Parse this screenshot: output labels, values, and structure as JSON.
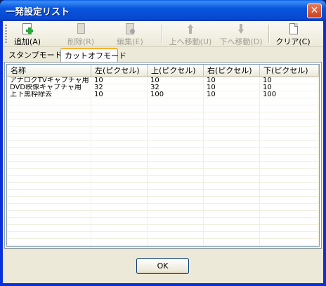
{
  "window": {
    "title": "一発設定リスト",
    "close_glyph": "✕"
  },
  "toolbar": {
    "add": "追加(A)",
    "delete": "削除(R)",
    "edit": "編集(E)",
    "move_up": "上へ移動(U)",
    "move_down": "下へ移動(D)",
    "clear": "クリア(C)"
  },
  "tabs": [
    {
      "label": "スタンプモード",
      "active": false
    },
    {
      "label": "カットオフモード",
      "active": true
    }
  ],
  "table": {
    "columns": [
      "名称",
      "左(ピクセル)",
      "上(ピクセル)",
      "右(ピクセル)",
      "下(ピクセル)"
    ],
    "rows": [
      [
        "アナログTVキャプチャ用",
        "10",
        "10",
        "10",
        "10"
      ],
      [
        "DVD映像キャプチャ用",
        "32",
        "32",
        "10",
        "10"
      ],
      [
        "上下黒枠除去",
        "10",
        "100",
        "10",
        "100"
      ]
    ]
  },
  "footer": {
    "ok_label": "OK"
  }
}
